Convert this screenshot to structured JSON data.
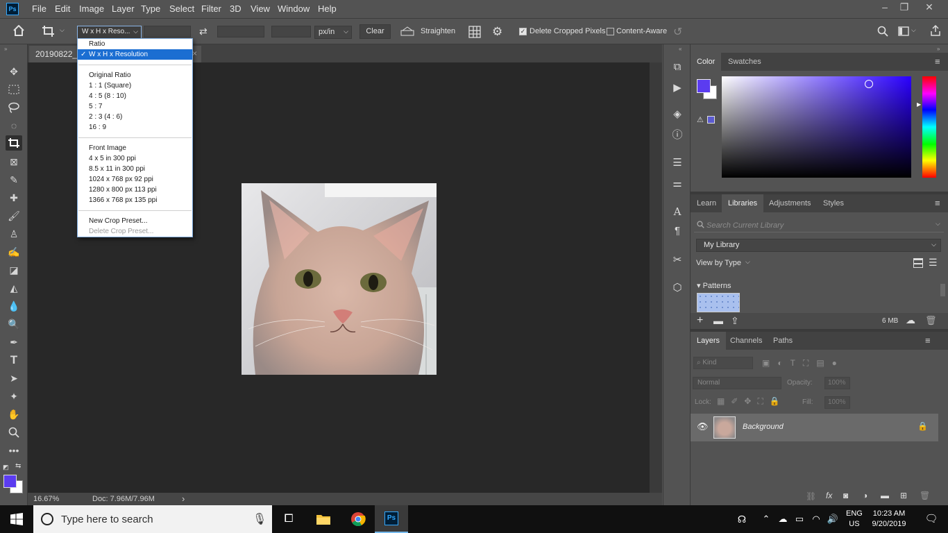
{
  "app": {
    "logo_text": "Ps"
  },
  "menu": [
    "File",
    "Edit",
    "Image",
    "Layer",
    "Type",
    "Select",
    "Filter",
    "3D",
    "View",
    "Window",
    "Help"
  ],
  "window_controls": {
    "minimize": "–",
    "restore": "❐",
    "close": "✕"
  },
  "options_bar": {
    "preset_select": "W x H x Reso...",
    "unit_select": "px/in",
    "clear_label": "Clear",
    "straighten_label": "Straighten",
    "delete_cropped_label": "Delete Cropped Pixels",
    "delete_cropped_checked": true,
    "content_aware_label": "Content-Aware",
    "content_aware_checked": false
  },
  "document": {
    "tab_title": "20190822_1",
    "zoom": "16.67%",
    "doc_info": "Doc: 7.96M/7.96M"
  },
  "crop_dropdown": {
    "header": "Ratio",
    "selected": "W x H x Resolution",
    "ratio_items": [
      "Original Ratio",
      "1 : 1 (Square)",
      "4 : 5 (8 : 10)",
      "5 : 7",
      "2 : 3 (4 : 6)",
      "16 : 9"
    ],
    "image_items": [
      "Front Image",
      "4 x 5 in 300 ppi",
      "8.5 x 11 in 300 ppi",
      "1024 x 768 px 92 ppi",
      "1280 x 800 px 113 ppi",
      "1366 x 768 px 135 ppi"
    ],
    "new_preset": "New Crop Preset...",
    "delete_preset": "Delete Crop Preset..."
  },
  "color_panel": {
    "tabs": [
      "Color",
      "Swatches"
    ],
    "foreground": "#5b3cf0",
    "background": "#ffffff"
  },
  "libraries_panel": {
    "tabs": [
      "Learn",
      "Libraries",
      "Adjustments",
      "Styles"
    ],
    "search_placeholder": "Search Current Library",
    "library_select": "My Library",
    "view_by": "View by Type",
    "section": "Patterns",
    "storage": "6 MB"
  },
  "layers_panel": {
    "tabs": [
      "Layers",
      "Channels",
      "Paths"
    ],
    "kind_filter": "Kind",
    "blend_mode": "Normal",
    "opacity_label": "Opacity:",
    "opacity_value": "100%",
    "lock_label": "Lock:",
    "fill_label": "Fill:",
    "fill_value": "100%",
    "layers": [
      {
        "name": "Background",
        "visible": true,
        "locked": true
      }
    ]
  },
  "taskbar": {
    "search_placeholder": "Type here to search",
    "lang_top": "ENG",
    "lang_bottom": "US",
    "time": "10:23 AM",
    "date": "9/20/2019"
  }
}
